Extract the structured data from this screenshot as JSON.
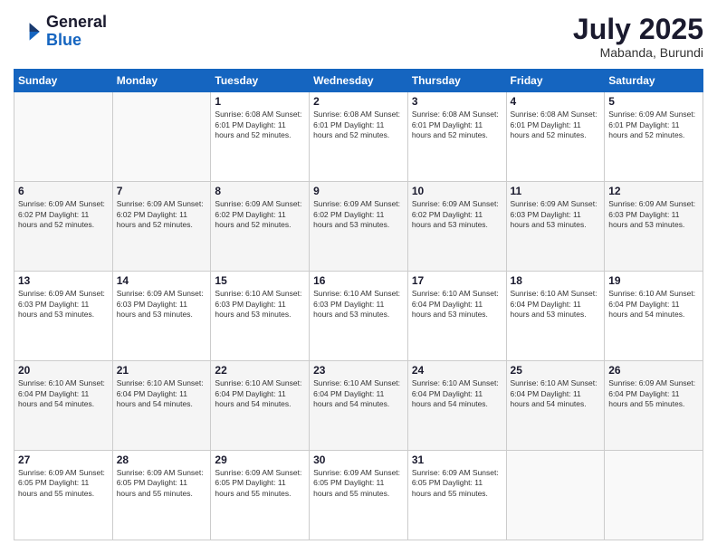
{
  "header": {
    "logo_general": "General",
    "logo_blue": "Blue",
    "month_year": "July 2025",
    "location": "Mabanda, Burundi"
  },
  "days_of_week": [
    "Sunday",
    "Monday",
    "Tuesday",
    "Wednesday",
    "Thursday",
    "Friday",
    "Saturday"
  ],
  "weeks": [
    [
      {
        "day": "",
        "info": ""
      },
      {
        "day": "",
        "info": ""
      },
      {
        "day": "1",
        "info": "Sunrise: 6:08 AM\nSunset: 6:01 PM\nDaylight: 11 hours and 52 minutes."
      },
      {
        "day": "2",
        "info": "Sunrise: 6:08 AM\nSunset: 6:01 PM\nDaylight: 11 hours and 52 minutes."
      },
      {
        "day": "3",
        "info": "Sunrise: 6:08 AM\nSunset: 6:01 PM\nDaylight: 11 hours and 52 minutes."
      },
      {
        "day": "4",
        "info": "Sunrise: 6:08 AM\nSunset: 6:01 PM\nDaylight: 11 hours and 52 minutes."
      },
      {
        "day": "5",
        "info": "Sunrise: 6:09 AM\nSunset: 6:01 PM\nDaylight: 11 hours and 52 minutes."
      }
    ],
    [
      {
        "day": "6",
        "info": "Sunrise: 6:09 AM\nSunset: 6:02 PM\nDaylight: 11 hours and 52 minutes."
      },
      {
        "day": "7",
        "info": "Sunrise: 6:09 AM\nSunset: 6:02 PM\nDaylight: 11 hours and 52 minutes."
      },
      {
        "day": "8",
        "info": "Sunrise: 6:09 AM\nSunset: 6:02 PM\nDaylight: 11 hours and 52 minutes."
      },
      {
        "day": "9",
        "info": "Sunrise: 6:09 AM\nSunset: 6:02 PM\nDaylight: 11 hours and 53 minutes."
      },
      {
        "day": "10",
        "info": "Sunrise: 6:09 AM\nSunset: 6:02 PM\nDaylight: 11 hours and 53 minutes."
      },
      {
        "day": "11",
        "info": "Sunrise: 6:09 AM\nSunset: 6:03 PM\nDaylight: 11 hours and 53 minutes."
      },
      {
        "day": "12",
        "info": "Sunrise: 6:09 AM\nSunset: 6:03 PM\nDaylight: 11 hours and 53 minutes."
      }
    ],
    [
      {
        "day": "13",
        "info": "Sunrise: 6:09 AM\nSunset: 6:03 PM\nDaylight: 11 hours and 53 minutes."
      },
      {
        "day": "14",
        "info": "Sunrise: 6:09 AM\nSunset: 6:03 PM\nDaylight: 11 hours and 53 minutes."
      },
      {
        "day": "15",
        "info": "Sunrise: 6:10 AM\nSunset: 6:03 PM\nDaylight: 11 hours and 53 minutes."
      },
      {
        "day": "16",
        "info": "Sunrise: 6:10 AM\nSunset: 6:03 PM\nDaylight: 11 hours and 53 minutes."
      },
      {
        "day": "17",
        "info": "Sunrise: 6:10 AM\nSunset: 6:04 PM\nDaylight: 11 hours and 53 minutes."
      },
      {
        "day": "18",
        "info": "Sunrise: 6:10 AM\nSunset: 6:04 PM\nDaylight: 11 hours and 53 minutes."
      },
      {
        "day": "19",
        "info": "Sunrise: 6:10 AM\nSunset: 6:04 PM\nDaylight: 11 hours and 54 minutes."
      }
    ],
    [
      {
        "day": "20",
        "info": "Sunrise: 6:10 AM\nSunset: 6:04 PM\nDaylight: 11 hours and 54 minutes."
      },
      {
        "day": "21",
        "info": "Sunrise: 6:10 AM\nSunset: 6:04 PM\nDaylight: 11 hours and 54 minutes."
      },
      {
        "day": "22",
        "info": "Sunrise: 6:10 AM\nSunset: 6:04 PM\nDaylight: 11 hours and 54 minutes."
      },
      {
        "day": "23",
        "info": "Sunrise: 6:10 AM\nSunset: 6:04 PM\nDaylight: 11 hours and 54 minutes."
      },
      {
        "day": "24",
        "info": "Sunrise: 6:10 AM\nSunset: 6:04 PM\nDaylight: 11 hours and 54 minutes."
      },
      {
        "day": "25",
        "info": "Sunrise: 6:10 AM\nSunset: 6:04 PM\nDaylight: 11 hours and 54 minutes."
      },
      {
        "day": "26",
        "info": "Sunrise: 6:09 AM\nSunset: 6:04 PM\nDaylight: 11 hours and 55 minutes."
      }
    ],
    [
      {
        "day": "27",
        "info": "Sunrise: 6:09 AM\nSunset: 6:05 PM\nDaylight: 11 hours and 55 minutes."
      },
      {
        "day": "28",
        "info": "Sunrise: 6:09 AM\nSunset: 6:05 PM\nDaylight: 11 hours and 55 minutes."
      },
      {
        "day": "29",
        "info": "Sunrise: 6:09 AM\nSunset: 6:05 PM\nDaylight: 11 hours and 55 minutes."
      },
      {
        "day": "30",
        "info": "Sunrise: 6:09 AM\nSunset: 6:05 PM\nDaylight: 11 hours and 55 minutes."
      },
      {
        "day": "31",
        "info": "Sunrise: 6:09 AM\nSunset: 6:05 PM\nDaylight: 11 hours and 55 minutes."
      },
      {
        "day": "",
        "info": ""
      },
      {
        "day": "",
        "info": ""
      }
    ]
  ]
}
